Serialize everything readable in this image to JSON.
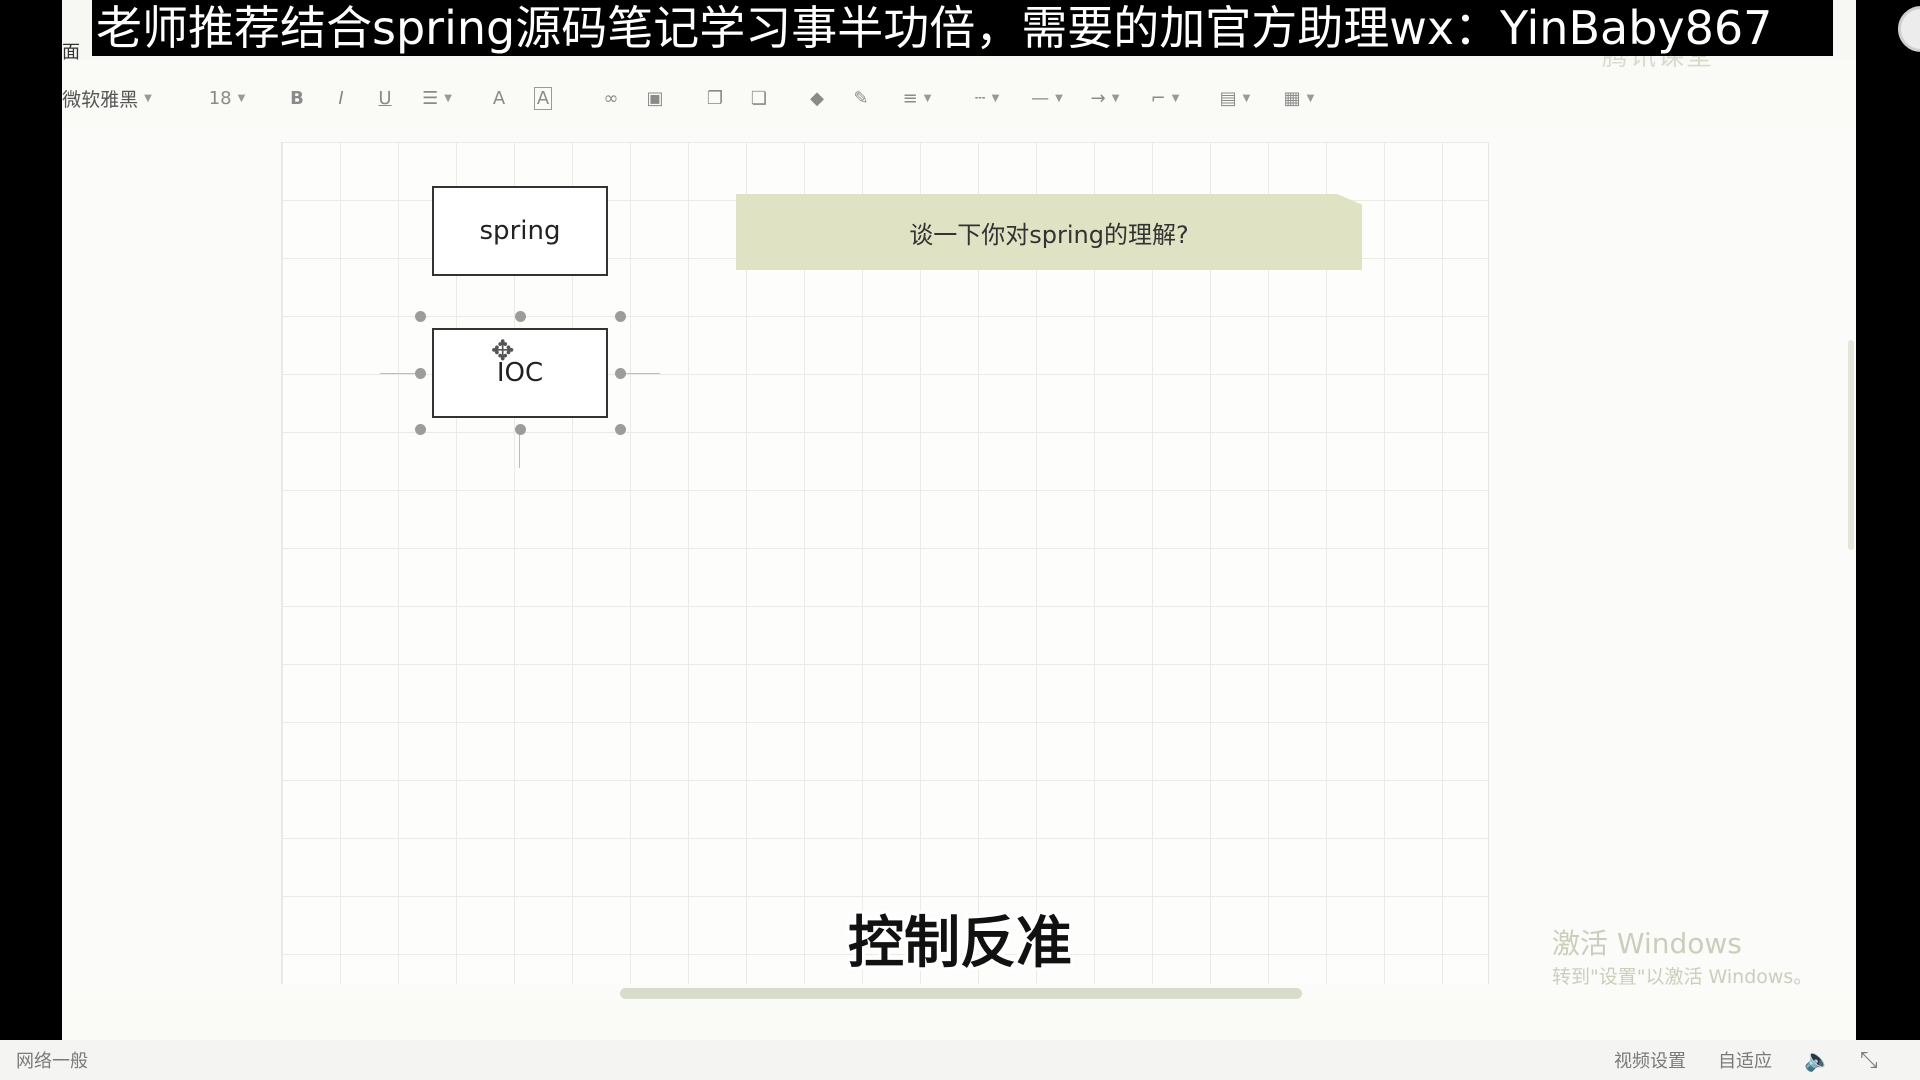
{
  "banner": {
    "text": "老师推荐结合spring源码笔记学习事半功倍，需要的加官方助理wx：YinBaby867"
  },
  "menu": {
    "fragment": "面"
  },
  "watermark_logo": "腾讯课堂",
  "toolbar": {
    "font_family": "微软雅黑",
    "font_size": "18",
    "bold": "B",
    "italic": "I",
    "underline": "U",
    "font_color": "A",
    "highlight": "A"
  },
  "diagram": {
    "nodes": [
      {
        "id": "spring",
        "label": "spring"
      },
      {
        "id": "ioc",
        "label": "IOC"
      }
    ],
    "note": {
      "text": "谈一下你对spring的理解?",
      "color": "#dfe2c3"
    }
  },
  "subtitle": {
    "text": "控制反准"
  },
  "windows_watermark": {
    "line1": "激活 Windows",
    "line2": "转到\"设置\"以激活 Windows。"
  },
  "statusbar": {
    "network": "网络一般",
    "video_settings": "视频设置",
    "fit": "自适应"
  },
  "colors": {
    "accent": "#dfe2c3",
    "background": "#fafaf7",
    "banner_bg": "#000000"
  }
}
